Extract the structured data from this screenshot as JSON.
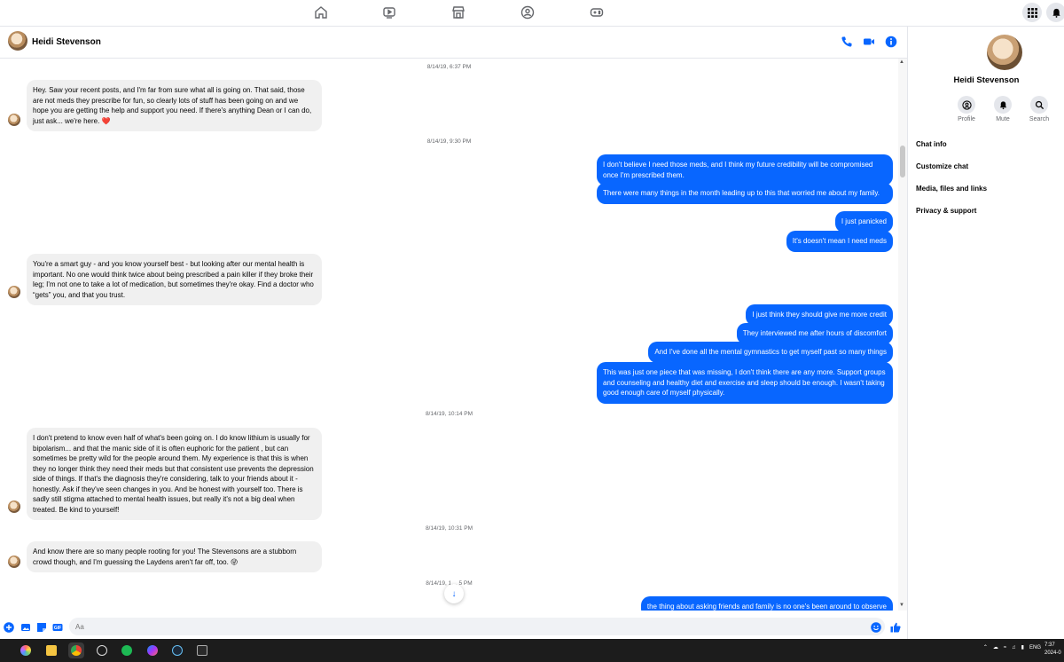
{
  "topnav": {
    "icons": [
      "home-icon",
      "watch-icon",
      "marketplace-icon",
      "groups-icon",
      "gaming-icon"
    ],
    "apps_icon": "grid-icon",
    "notifications_icon": "bell-icon"
  },
  "chat": {
    "contact_name": "Heidi Stevenson",
    "header_icons": [
      "phone-icon",
      "video-icon",
      "info-icon"
    ]
  },
  "messages": {
    "ts1": "8/14/19, 6:37 PM",
    "m1": "Hey. Saw your recent posts, and I'm far from sure what all is going on. That said, those are not meds they prescribe for fun, so clearly lots of stuff has been going on and we hope you are getting the help and support you need. If there's anything Dean or I can do, just ask... we're here. ❤️",
    "ts2": "8/14/19, 9:30 PM",
    "m2": "I don't believe I need those meds, and I think my future credibility will be compromised once I'm prescribed them.",
    "m3": "There were many things in the month leading up to this that worried me about my family.",
    "m4": "I just panicked",
    "m5": "It's doesn't mean I need meds",
    "m6": "You're a smart guy - and you know yourself best - but looking after our mental health is important. No one would think twice about being prescribed a pain killer if they broke their leg; I'm not one to take a lot of medication, but sometimes they're okay. Find a doctor who “gets” you, and that you trust.",
    "m7": "I just think they should give me more credit",
    "m8": "They interviewed me after hours of discomfort",
    "m9": "And I've done all the mental gymnastics to get myself past so many things",
    "m10": "This was just one piece that was missing, I don't think there are any more. Support groups and counseling and healthy diet and exercise and sleep should be enough. I wasn't taking good enough care of myself physically.",
    "ts3": "8/14/19, 10:14 PM",
    "m11": "I don't pretend to know even half of what's been going on. I do know lithium is usually for bipolarism... and that the manic side of it is often euphoric for the patient , but can sometimes be pretty wild for the people around them. My experience is that this is when they no longer think they need their meds but that consistent use prevents the depression side of things.  If that's the diagnosis they're considering, talk to your friends about it - honestly. Ask if they've seen changes in you. And be honest with yourself too. There is sadly still stigma attached to mental health issues, but really it's not a big deal when treated. Be kind to yourself!",
    "ts4": "8/14/19, 10:31 PM",
    "m12": "And know there are so many people rooting for you! The Stevensons are a stubborn crowd though, and I'm guessing the Laydens aren't far off, too. 😜",
    "ts5": "8/14/19, 1… 5 PM",
    "m13": "the thing about asking friends and family is no one's been around to observe"
  },
  "composer": {
    "placeholder": "Aa",
    "icons": [
      "plus-icon",
      "photo-icon",
      "sticker-icon",
      "gif-icon",
      "emoji-icon",
      "like-icon"
    ]
  },
  "panel": {
    "name": "Heidi Stevenson",
    "actions": {
      "profile": "Profile",
      "mute": "Mute",
      "search": "Search"
    },
    "items": {
      "chat_info": "Chat info",
      "customize": "Customize chat",
      "media": "Media, files and links",
      "privacy": "Privacy & support"
    }
  },
  "taskbar": {
    "lang": "ENG",
    "time": "7:37",
    "date": "2024-0"
  },
  "colors": {
    "accent": "#0866ff",
    "incoming_bubble": "#f0f0f0",
    "taskbar": "#1c1c1c"
  }
}
